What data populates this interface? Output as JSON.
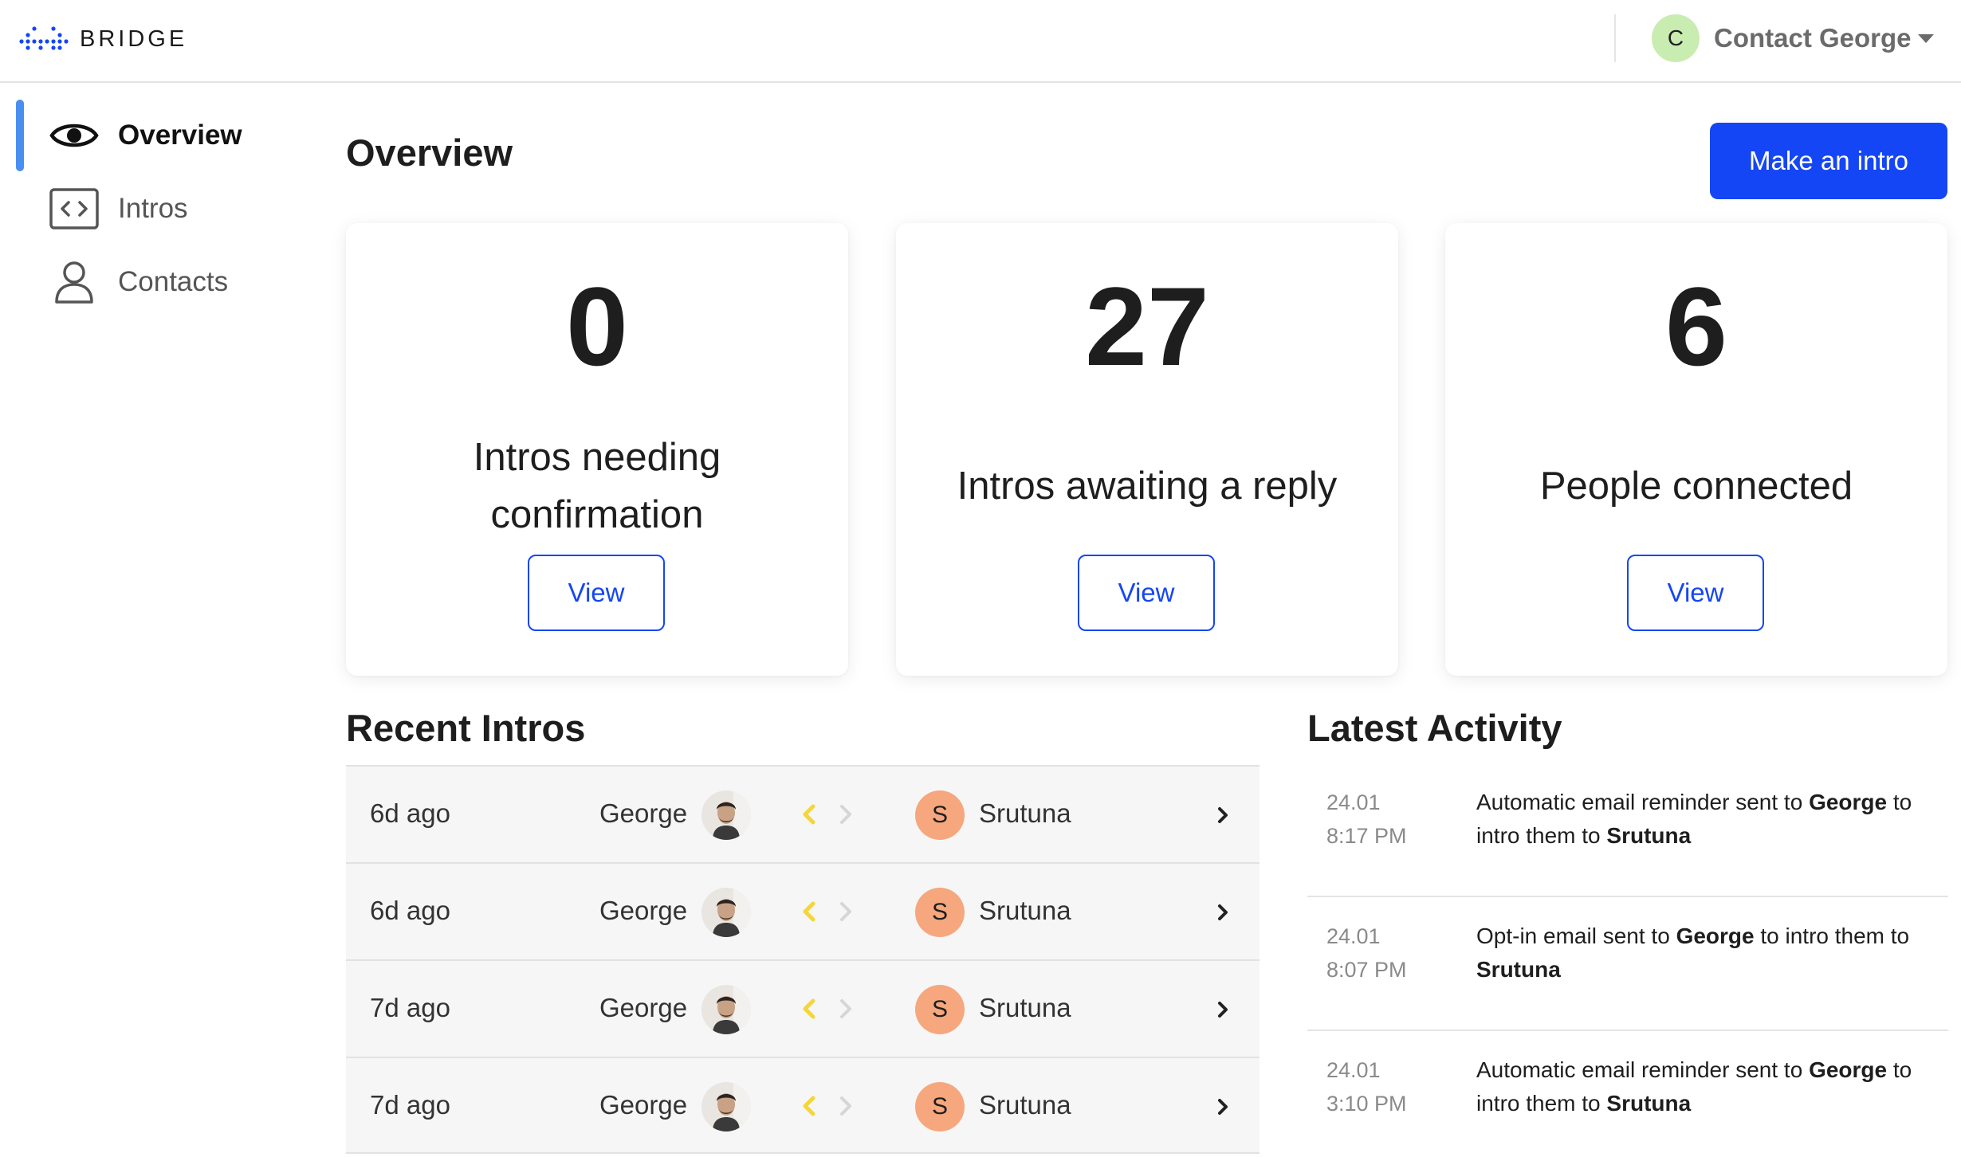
{
  "app": {
    "logo_text": "BRIDGE"
  },
  "account": {
    "initial": "C",
    "name": "Contact George"
  },
  "sidebar": {
    "items": [
      {
        "label": "Overview",
        "icon": "eye-icon",
        "active": true
      },
      {
        "label": "Intros",
        "icon": "code-brackets-icon",
        "active": false
      },
      {
        "label": "Contacts",
        "icon": "person-icon",
        "active": false
      }
    ]
  },
  "page": {
    "title": "Overview",
    "make_intro_label": "Make an intro"
  },
  "stats": [
    {
      "value": "0",
      "label": "Intros needing confirmation",
      "button": "View"
    },
    {
      "value": "27",
      "label": "Intros awaiting a reply",
      "button": "View"
    },
    {
      "value": "6",
      "label": "People connected",
      "button": "View"
    }
  ],
  "recent_intros": {
    "title": "Recent Intros",
    "rows": [
      {
        "time": "6d ago",
        "from": "George",
        "to_initial": "S",
        "to": "Srutuna"
      },
      {
        "time": "6d ago",
        "from": "George",
        "to_initial": "S",
        "to": "Srutuna"
      },
      {
        "time": "7d ago",
        "from": "George",
        "to_initial": "S",
        "to": "Srutuna"
      },
      {
        "time": "7d ago",
        "from": "George",
        "to_initial": "S",
        "to": "Srutuna"
      }
    ]
  },
  "latest_activity": {
    "title": "Latest Activity",
    "items": [
      {
        "date": "24.01",
        "time": "8:17 PM",
        "parts": [
          "Automatic email reminder sent to ",
          "George",
          " to intro them to ",
          "Srutuna",
          ""
        ]
      },
      {
        "date": "24.01",
        "time": "8:07 PM",
        "parts": [
          "Opt-in email sent to ",
          "George",
          " to intro them to ",
          "Srutuna",
          ""
        ]
      },
      {
        "date": "24.01",
        "time": "3:10 PM",
        "parts": [
          "Automatic email reminder sent to ",
          "George",
          " to intro them to ",
          "Srutuna",
          ""
        ]
      }
    ]
  },
  "colors": {
    "accent": "#1546f5",
    "active_indicator": "#4a8ff0",
    "account_avatar": "#c9ecb0",
    "contact_avatar": "#f6a77e",
    "arrow_active": "#f5d63a",
    "arrow_inactive": "#d6d6d6"
  }
}
